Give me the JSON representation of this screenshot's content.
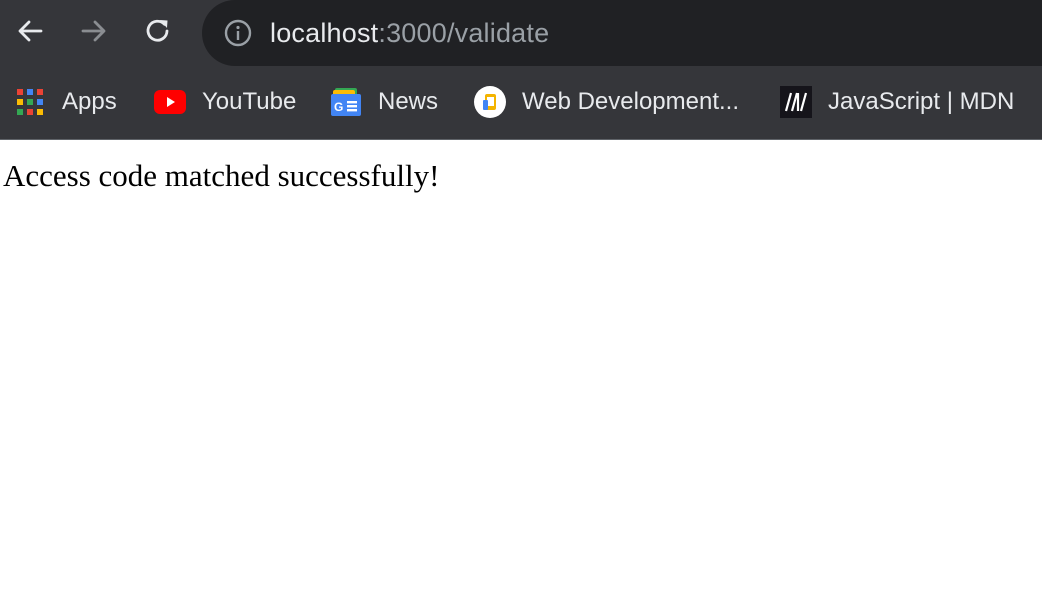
{
  "browser": {
    "address_bar": {
      "host": "localhost",
      "rest": ":3000/validate"
    },
    "bookmarks": [
      {
        "label": "Apps",
        "icon": "apps-grid-icon"
      },
      {
        "label": "YouTube",
        "icon": "youtube-icon"
      },
      {
        "label": "News",
        "icon": "google-news-icon"
      },
      {
        "label": "Web Development...",
        "icon": "web-development-icon"
      },
      {
        "label": "JavaScript | MDN",
        "icon": "mdn-icon"
      }
    ]
  },
  "page": {
    "message": "Access code matched successfully!"
  },
  "colors": {
    "toolbar_bg": "#35363a",
    "omnibox_bg": "#202124",
    "text_light": "#e8eaed",
    "text_muted": "#9aa0a6",
    "youtube_red": "#ff0000",
    "news_blue": "#4285f4"
  }
}
